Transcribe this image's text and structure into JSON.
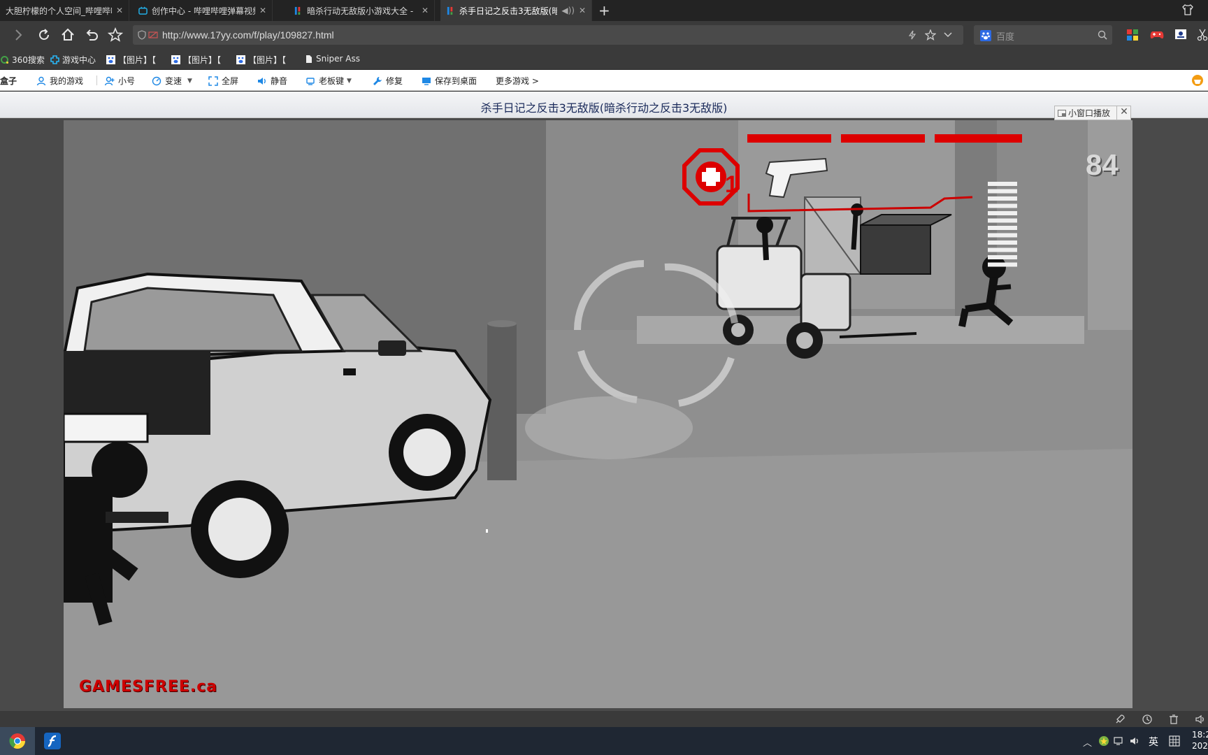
{
  "browser": {
    "tabs": [
      {
        "title": "大胆柠檬的个人空间_哔哩哔哩",
        "active": false
      },
      {
        "title": "创作中心 - 哔哩哔哩弹幕视频",
        "active": false
      },
      {
        "title": "暗杀行动无敌版小游戏大全 -",
        "active": false
      },
      {
        "title": "杀手日记之反击3无敌版(暗",
        "active": true
      }
    ],
    "url": "http://www.17yy.com/f/play/109827.html",
    "search_placeholder": "百度"
  },
  "bookmarks": [
    {
      "label": "360搜索",
      "icon": "360-search-icon"
    },
    {
      "label": "游戏中心",
      "icon": "game-center-icon"
    },
    {
      "label": "【图片】【",
      "icon": "baidu-paw-icon"
    },
    {
      "label": "【图片】【",
      "icon": "baidu-paw-icon"
    },
    {
      "label": "【图片】【",
      "icon": "baidu-paw-icon"
    },
    {
      "label": "Sniper Ass",
      "icon": "page-icon"
    }
  ],
  "game_toolbar": {
    "box_label": "盒子",
    "items": [
      {
        "label": "我的游戏",
        "icon": "user-icon"
      },
      {
        "label": "小号",
        "icon": "add-user-icon"
      },
      {
        "label": "变速",
        "icon": "speed-icon"
      },
      {
        "label": "全屏",
        "icon": "fullscreen-icon"
      },
      {
        "label": "静音",
        "icon": "speaker-icon"
      },
      {
        "label": "老板键",
        "icon": "boss-key-icon"
      },
      {
        "label": "修复",
        "icon": "wrench-icon"
      },
      {
        "label": "保存到桌面",
        "icon": "desktop-icon"
      },
      {
        "label": "更多游戏 >",
        "icon": ""
      }
    ]
  },
  "page": {
    "title": "杀手日记之反击3无敌版(暗杀行动之反击3无敌版)",
    "mini_play_label": "小窗口播放"
  },
  "game": {
    "ammo": "84",
    "lives": "1",
    "logo": "GAMESFREE.ca"
  },
  "taskbar": {
    "ime": "英",
    "time": "18:2",
    "date": "202"
  },
  "colors": {
    "hud_red": "#dd0000",
    "tab_active": "#3a3a3a",
    "title_text": "#1a2a5a"
  }
}
